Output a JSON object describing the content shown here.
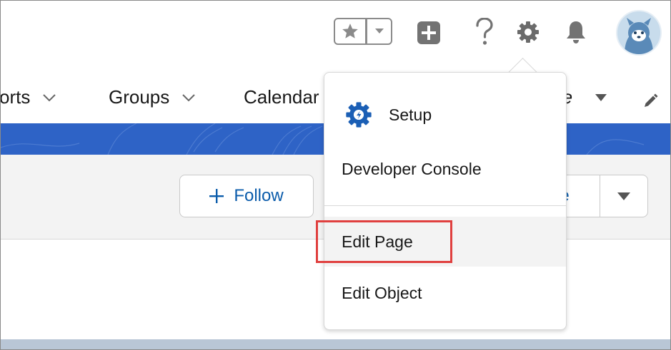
{
  "header": {
    "icons": [
      "star-icon",
      "chevron-down-icon",
      "plus-square-icon",
      "help-icon",
      "gear-icon",
      "bell-icon",
      "avatar"
    ]
  },
  "nav": {
    "items": [
      {
        "label": "orts"
      },
      {
        "label": "Groups"
      },
      {
        "label": "Calendar"
      },
      {
        "label": "re"
      }
    ]
  },
  "page_header": {
    "follow_label": "Follow",
    "right_button_label": "ie"
  },
  "menu": {
    "items": [
      {
        "label": "Setup",
        "icon": "setup-gear-icon"
      },
      {
        "label": "Developer Console"
      },
      {
        "label": "Edit Page",
        "highlighted": true
      },
      {
        "label": "Edit Object"
      }
    ]
  },
  "colors": {
    "accent": "#0b5cab",
    "banner": "#2e63c6",
    "highlight_border": "#e0403f"
  }
}
